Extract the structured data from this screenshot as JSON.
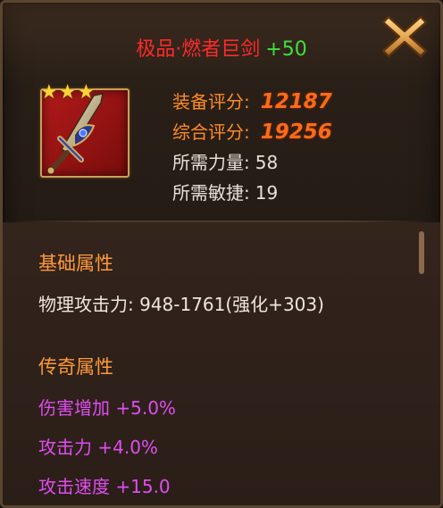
{
  "item": {
    "name": "极品·燃者巨剑",
    "enhance": "+50",
    "stars": [
      "★",
      "★",
      "★"
    ],
    "icon": "sword-icon"
  },
  "stats": {
    "equip_score_label": "装备评分:",
    "equip_score": "12187",
    "total_score_label": "综合评分:",
    "total_score": "19256",
    "req_str_label": "所需力量:",
    "req_str": "58",
    "req_agi_label": "所需敏捷:",
    "req_agi": "19"
  },
  "basic": {
    "title": "基础属性",
    "lines": [
      "物理攻击力: 948-1761(强化+303)"
    ]
  },
  "legend": {
    "title": "传奇属性",
    "lines": [
      "伤害增加 +5.0%",
      "攻击力 +4.0%",
      "攻击速度 +15.0"
    ]
  },
  "colors": {
    "item_name": "#ff2a2a",
    "enhance": "#3fe03f",
    "score": "#ff6a1a",
    "section_title": "#ff9a3a",
    "legend_attr": "#e04cf0",
    "close_icon": "#e8b060"
  }
}
